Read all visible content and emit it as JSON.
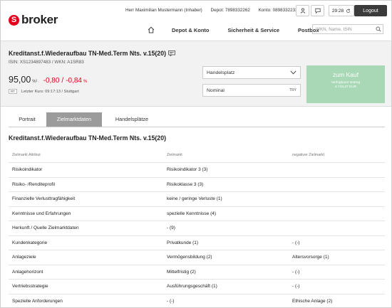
{
  "header": {
    "logo_text": "broker",
    "logo_glyph": "S",
    "user": "Herr Maximilian Mustermann (Inhaber)",
    "depot": "Depot: 7898332262",
    "konto": "Konto: 0898332233",
    "time": "29:28",
    "logout": "Logout",
    "nav": [
      "Depot & Konto",
      "Sicherheit & Service",
      "Postbox"
    ],
    "search_placeholder": "WKN, Name, ISIN"
  },
  "security": {
    "title": "Kreditanst.f.Wiederaufbau TN-Med.Term Nts. v.15(20)",
    "ids": "ISIN: XS1234897483 / WKN: A1SR83",
    "price": "95,00",
    "price_unit": "%¹",
    "change_abs": "-0,80",
    "change_sep": "/",
    "change_pct": "-0,84",
    "pct_sign": "%",
    "badge": "RT",
    "last": "Letzter Kurs: 09:17:13 / Stuttgart",
    "place_label": "Handelsplatz",
    "type_label": "Nominal",
    "type_code": "TRY",
    "buy_label": "zum Kauf",
    "buy_sub": "Verfügbarer Betrag",
    "buy_amount": "3.719,47 EUR"
  },
  "tabs": [
    "Portrait",
    "Zielmarktdaten",
    "Handelsplätze"
  ],
  "content": {
    "title": "Kreditanst.f.Wiederaufbau TN-Med.Term Nts. v.15(20)",
    "headers": [
      "Zielmarkt Attribut",
      "Zielmarkt",
      "negativer Zielmarkt"
    ],
    "rows": [
      [
        "Risikoindikator",
        "Risikoindikator 3 (3)",
        ""
      ],
      [
        "Risiko- /Renditeprofil",
        "Risikoklasse 3 (3)",
        ""
      ],
      [
        "Finanzielle Verlusttragfähigkeit",
        "keine / geringe Verluste (1)",
        ""
      ],
      [
        "Kenntnisse und Erfahrungen",
        "spezielle Kenntnisse (4)",
        ""
      ],
      [
        "Herkunft / Quelle Zielmarktdaten",
        "- (9)",
        ""
      ],
      [
        "Kundenkategorie",
        "Privatkunde (1)",
        "- (-)"
      ],
      [
        "Anlageziele",
        "Vermögensbildung (2)",
        "Altersvorsorge (1)"
      ],
      [
        "Anlagehorizont",
        "Mittelfristig (2)",
        "- (-)"
      ],
      [
        "Vertriebsstrategie",
        "Ausführungsgeschäft (1)",
        "- (-)"
      ],
      [
        "Spezielle Anforderungen",
        "- (-)",
        "Ethische Anlage (2)"
      ]
    ]
  },
  "colors": {
    "brand": "#e2001a",
    "buy": "#a8d8b6",
    "tab_active": "#9b9b9b"
  }
}
